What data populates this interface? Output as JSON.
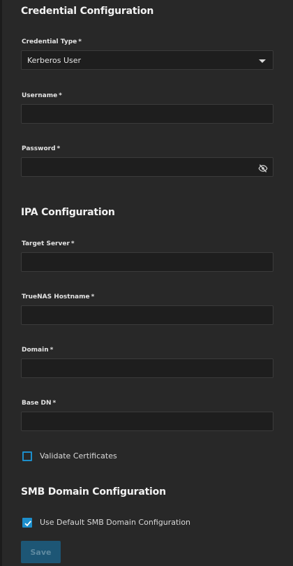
{
  "sections": {
    "credential": "Credential Configuration",
    "ipa": "IPA Configuration",
    "smb": "SMB Domain Configuration"
  },
  "fields": {
    "credential_type": {
      "label": "Credential Type",
      "value": "Kerberos User"
    },
    "username": {
      "label": "Username",
      "value": ""
    },
    "password": {
      "label": "Password",
      "value": ""
    },
    "target_server": {
      "label": "Target Server",
      "value": ""
    },
    "truenas_hostname": {
      "label": "TrueNAS Hostname",
      "value": ""
    },
    "domain": {
      "label": "Domain",
      "value": ""
    },
    "base_dn": {
      "label": "Base DN",
      "value": ""
    }
  },
  "required_marker": "*",
  "checkboxes": {
    "validate_certificates": {
      "label": "Validate Certificates",
      "checked": false
    },
    "use_default_smb": {
      "label": "Use Default SMB Domain Configuration",
      "checked": true
    }
  },
  "save_label": "Save",
  "colors": {
    "background": "#282828",
    "input_background": "#1e1e1e",
    "accent": "#1d8ecb",
    "button_disabled": "#1d5675"
  },
  "icons": {
    "password_toggle": "eye-off-icon",
    "select_caret": "chevron-down-icon",
    "checkmark": "check-icon"
  }
}
